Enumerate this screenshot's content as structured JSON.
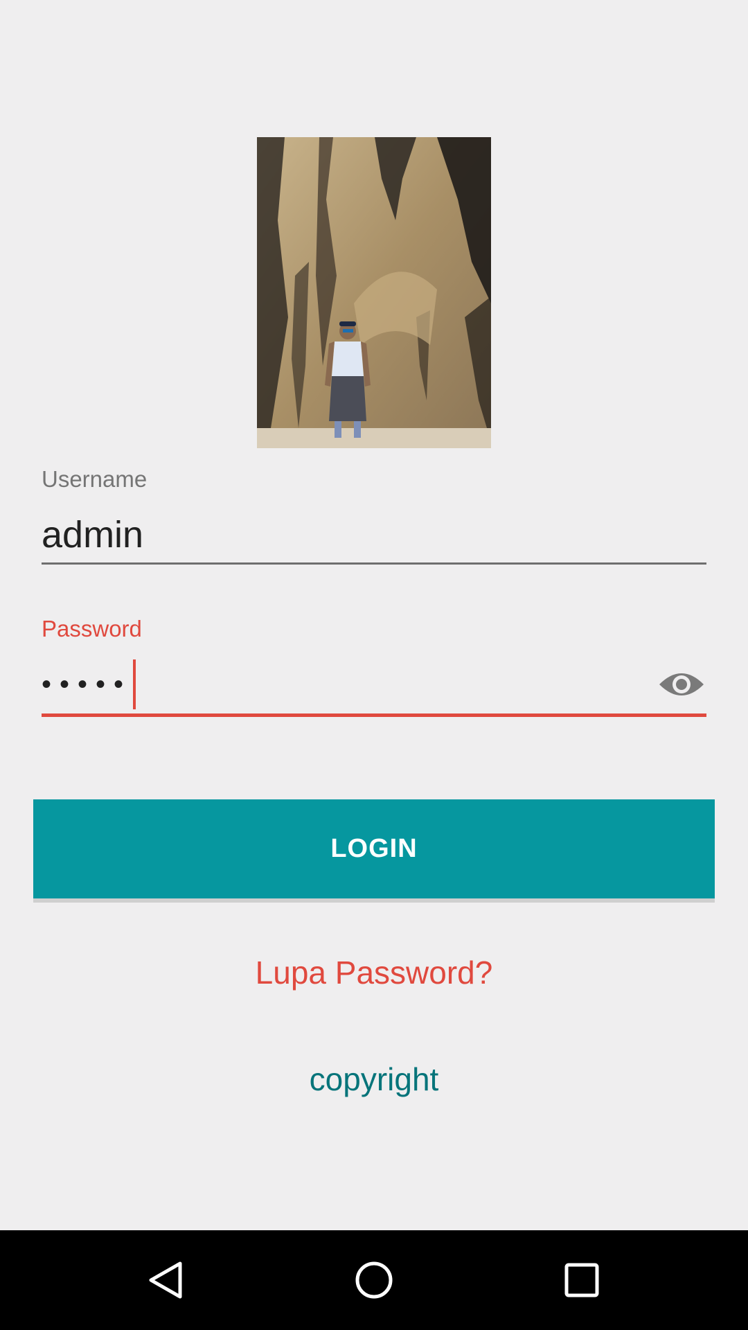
{
  "profile": {
    "photo": "profile-photo"
  },
  "username": {
    "label": "Username",
    "value": "admin"
  },
  "password": {
    "label": "Password",
    "masked_value": "•••••",
    "toggle_icon": "eye-icon"
  },
  "login": {
    "label": "LOGIN"
  },
  "links": {
    "forgot": "Lupa Password?",
    "copyright": "copyright"
  },
  "navbar": {
    "back_icon": "back-icon",
    "home_icon": "home-icon",
    "recents_icon": "recents-icon"
  },
  "colors": {
    "background": "#efeeef",
    "accent": "#06979f",
    "error": "#e0493e",
    "link_teal": "#06747a",
    "navbar": "#000000"
  }
}
